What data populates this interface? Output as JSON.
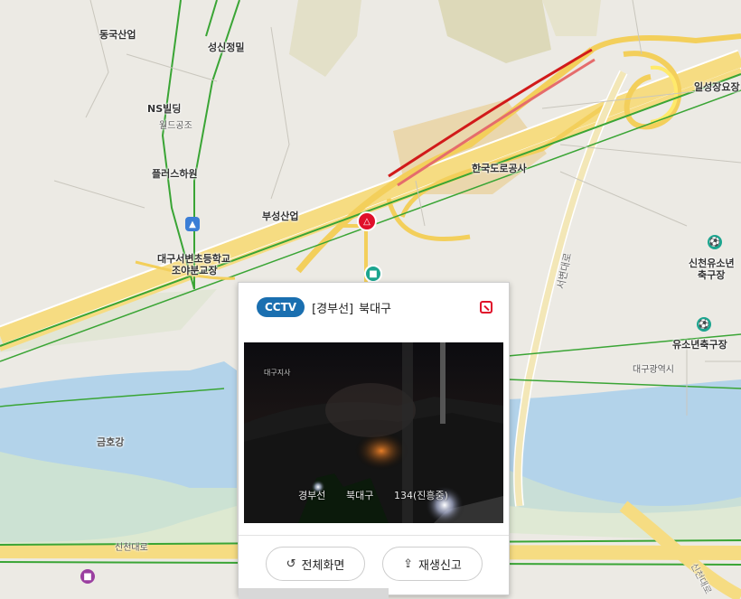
{
  "colors": {
    "accent": "#1a6fb0",
    "alert": "#e0102a",
    "road_major": "#f3cf5b",
    "road_jam": "#d11a1a",
    "road_green": "#3aa535",
    "river": "#b3d3ea"
  },
  "map": {
    "labels": {
      "donggueup": "동국산업",
      "seongsin": "성신정밀",
      "ns_building": "NS빌딩",
      "world_gongsa": "월드공조",
      "plus_hwan": "플러스하원",
      "busseong": "부성산업",
      "korea_expressway": "한국도로공사",
      "ilsong": "일성장요장",
      "school": "대구서변초등학교",
      "garage": "조야분교장",
      "sincheon_yuso": "신천유소년",
      "football_ground": "축구장",
      "yuso_football": "유소년축구장",
      "daegu_city": "대구광역시",
      "geumho_river": "금호강",
      "sincheon_daero": "신천대로",
      "seobyeon_daero": "서변대로",
      "sincheon_daero_right": "신천대로"
    },
    "icons": [
      "school-icon",
      "football-icon",
      "cctv-icon",
      "warning-icon",
      "bus-icon"
    ]
  },
  "popup": {
    "badge": "CCTV",
    "route": "[경부선]",
    "region": "북대구",
    "video": {
      "overlay_location": "대구지사",
      "overlay_road": "경부선",
      "overlay_region": "북대구",
      "overlay_km": "134(진흥중)"
    },
    "buttons": {
      "fullscreen": "전체화면",
      "report": "재생신고"
    }
  }
}
